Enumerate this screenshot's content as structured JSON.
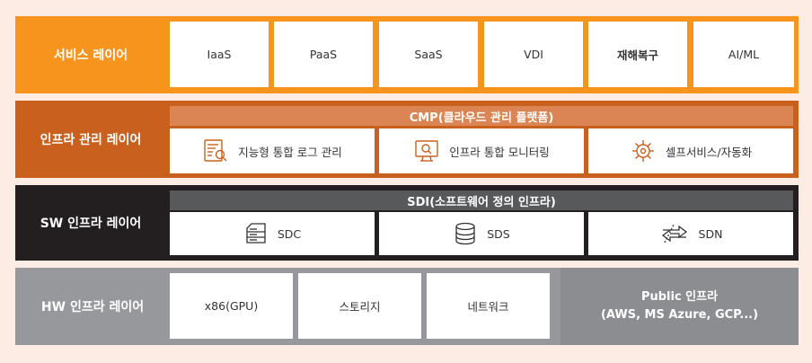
{
  "colors": {
    "service": "#f7941d",
    "infra": "#c9601e",
    "sw": "#231f20",
    "hw": "#97989b",
    "background": "#fcece3"
  },
  "service_layer": {
    "label": "서비스 레이어",
    "items": [
      "IaaS",
      "PaaS",
      "SaaS",
      "VDI",
      "재해복구",
      "AI/ML"
    ]
  },
  "infra_layer": {
    "label": "인프라 관리 레이어",
    "banner": "CMP(클라우드 관리 플랫폼)",
    "items": [
      {
        "label": "지능형 통합 로그 관리",
        "icon": "log-document-icon"
      },
      {
        "label": "인프라 통합 모니터링",
        "icon": "monitor-search-icon"
      },
      {
        "label": "셀프서비스/자동화",
        "icon": "gear-automation-icon"
      }
    ]
  },
  "sw_layer": {
    "label": "SW 인프라 레이어",
    "banner": "SDI(소프트웨어 정의 인프라)",
    "items": [
      {
        "label": "SDC",
        "icon": "server-icon"
      },
      {
        "label": "SDS",
        "icon": "database-icon"
      },
      {
        "label": "SDN",
        "icon": "network-arrows-icon"
      }
    ]
  },
  "hw_layer": {
    "label": "HW 인프라 레이어",
    "items": [
      "x86(GPU)",
      "스토리지",
      "네트워크"
    ],
    "public_line1": "Public 인프라",
    "public_line2": "(AWS, MS Azure, GCP...)"
  }
}
